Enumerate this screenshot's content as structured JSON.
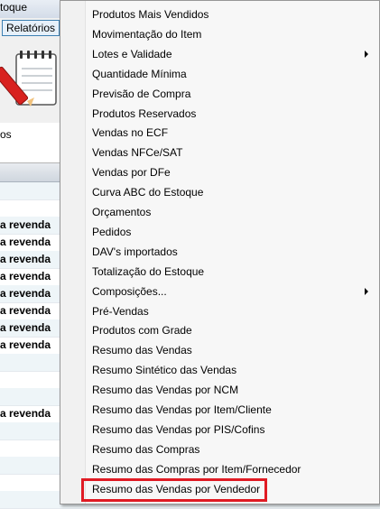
{
  "window": {
    "title": "toque"
  },
  "menubar": {
    "active_menu": "Relatórios"
  },
  "tabs": {
    "visible_label": "os"
  },
  "grid": {
    "rows": [
      {
        "text": ""
      },
      {
        "text": ""
      },
      {
        "text": "a revenda"
      },
      {
        "text": "a revenda"
      },
      {
        "text": "a revenda"
      },
      {
        "text": "a revenda"
      },
      {
        "text": "a revenda"
      },
      {
        "text": "a revenda"
      },
      {
        "text": "a revenda"
      },
      {
        "text": "a revenda"
      },
      {
        "text": ""
      },
      {
        "text": ""
      },
      {
        "text": ""
      },
      {
        "text": "a revenda"
      },
      {
        "text": ""
      },
      {
        "text": ""
      },
      {
        "text": ""
      },
      {
        "text": ""
      },
      {
        "text": ""
      }
    ]
  },
  "context_menu": {
    "items": [
      {
        "label": "Produtos Mais Vendidos"
      },
      {
        "label": "Movimentação do Item"
      },
      {
        "label": "Lotes e Validade",
        "submenu": true
      },
      {
        "label": "Quantidade Mínima"
      },
      {
        "label": "Previsão de Compra"
      },
      {
        "label": "Produtos Reservados"
      },
      {
        "label": "Vendas no ECF"
      },
      {
        "label": "Vendas NFCe/SAT"
      },
      {
        "label": "Vendas por DFe"
      },
      {
        "label": "Curva ABC do Estoque"
      },
      {
        "label": "Orçamentos"
      },
      {
        "label": "Pedidos"
      },
      {
        "label": "DAV's importados"
      },
      {
        "label": "Totalização do Estoque"
      },
      {
        "label": "Composições...",
        "submenu": true
      },
      {
        "label": "Pré-Vendas"
      },
      {
        "label": "Produtos com Grade"
      },
      {
        "label": "Resumo das Vendas"
      },
      {
        "label": "Resumo Sintético das Vendas"
      },
      {
        "label": "Resumo das Vendas por NCM"
      },
      {
        "label": "Resumo das Vendas por Item/Cliente"
      },
      {
        "label": "Resumo das Vendas por PIS/Cofins"
      },
      {
        "label": "Resumo das Compras"
      },
      {
        "label": "Resumo das Compras por Item/Fornecedor"
      },
      {
        "label": "Resumo das Vendas por Vendedor"
      }
    ],
    "highlighted_item": "Resumo das Vendas por Vendedor",
    "highlight_color": "#e01b24"
  }
}
